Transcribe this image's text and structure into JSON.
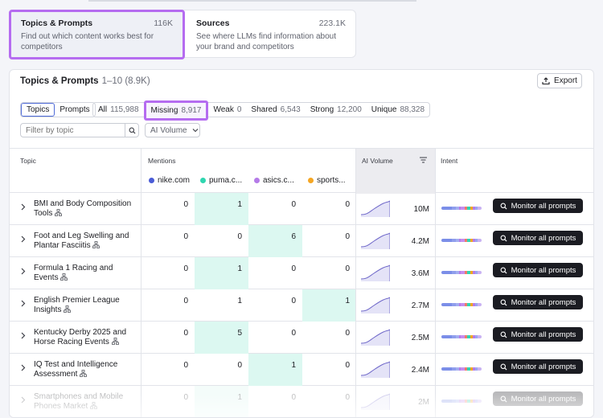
{
  "cards": [
    {
      "title": "Topics & Prompts",
      "count": "116K",
      "desc": "Find out which content works best for competitors"
    },
    {
      "title": "Sources",
      "count": "223.1K",
      "desc": "See where LLMs find information about your brand and competitors"
    }
  ],
  "panel": {
    "title": "Topics & Prompts",
    "range": "1–10 (8.9K)",
    "export_label": "Export"
  },
  "view_toggle": [
    "Topics",
    "Prompts"
  ],
  "filters": [
    {
      "label": "All",
      "count": "115,988"
    },
    {
      "label": "Missing",
      "count": "8,917"
    },
    {
      "label": "Weak",
      "count": "0"
    },
    {
      "label": "Shared",
      "count": "6,543"
    },
    {
      "label": "Strong",
      "count": "12,200"
    },
    {
      "label": "Unique",
      "count": "88,328"
    }
  ],
  "search": {
    "placeholder": "Filter by topic"
  },
  "volume_select": "AI Volume",
  "table": {
    "headers": {
      "topic": "Topic",
      "mentions": "Mentions",
      "ai_volume": "AI Volume",
      "intent": "Intent"
    },
    "brands": [
      {
        "name": "nike.com",
        "color": "#4a5cd6"
      },
      {
        "name": "puma.c...",
        "color": "#2fd6b0"
      },
      {
        "name": "asics.c...",
        "color": "#b57be8"
      },
      {
        "name": "sports...",
        "color": "#f5a623"
      }
    ],
    "button_label": "Monitor all prompts",
    "rows": [
      {
        "line1": "BMI and Body Composition",
        "line2": "Tools",
        "values": [
          "0",
          "1",
          "0",
          "0"
        ],
        "highlight": 1,
        "volume": "10M"
      },
      {
        "line1": "Foot and Leg Swelling and",
        "line2": "Plantar Fasciitis",
        "values": [
          "0",
          "0",
          "6",
          "0"
        ],
        "highlight": 2,
        "volume": "4.2M"
      },
      {
        "line1": "Formula 1 Racing and",
        "line2": "Events",
        "values": [
          "0",
          "1",
          "0",
          "0"
        ],
        "highlight": 1,
        "volume": "3.6M"
      },
      {
        "line1": "English Premier League",
        "line2": "Insights",
        "values": [
          "0",
          "1",
          "0",
          "1"
        ],
        "highlight": 3,
        "volume": "2.7M"
      },
      {
        "line1": "Kentucky Derby 2025 and",
        "line2": "Horse Racing Events",
        "values": [
          "0",
          "5",
          "0",
          "0"
        ],
        "highlight": 1,
        "volume": "2.5M"
      },
      {
        "line1": "IQ Test and Intelligence",
        "line2": "Assessment",
        "values": [
          "0",
          "0",
          "1",
          "0"
        ],
        "highlight": 2,
        "volume": "2.4M"
      },
      {
        "line1": "Smartphones and Mobile",
        "line2": "Phones Market",
        "values": [
          "0",
          "1",
          "0",
          "0"
        ],
        "highlight": 1,
        "volume": "2M"
      }
    ]
  },
  "colors": {
    "accent_outline": "#b56cf0",
    "highlight_cell": "#dcf8f1",
    "button_bg": "#1b1c22",
    "intent_bar": [
      "#7b8ee8",
      "#9aa8ef",
      "#b57be8",
      "#ef7b6b",
      "#2fd6b0",
      "#f5a623",
      "#b57be8"
    ]
  }
}
